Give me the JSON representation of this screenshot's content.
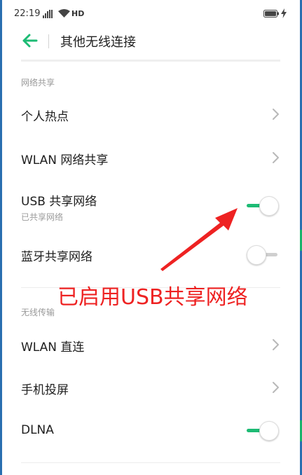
{
  "status_bar": {
    "time": "22:19",
    "network_label": "HD",
    "icons": [
      "signal-icon",
      "wifi-icon",
      "battery-icon",
      "charging-icon"
    ]
  },
  "app_bar": {
    "title": "其他无线连接",
    "back_icon": "back-arrow-icon"
  },
  "sections": {
    "sharing": {
      "header": "网络共享",
      "items": [
        {
          "label": "个人热点",
          "control": "chevron"
        },
        {
          "label": "WLAN 网络共享",
          "control": "chevron"
        },
        {
          "label": "USB 共享网络",
          "subtitle": "已共享网络",
          "control": "toggle",
          "on": true
        },
        {
          "label": "蓝牙共享网络",
          "control": "toggle",
          "on": false
        }
      ]
    },
    "wireless": {
      "header": "无线传输",
      "items": [
        {
          "label": "WLAN 直连",
          "control": "chevron"
        },
        {
          "label": "手机投屏",
          "control": "chevron"
        },
        {
          "label": "DLNA",
          "control": "toggle",
          "on": true
        }
      ]
    }
  },
  "annotation": {
    "text": "已启用USB共享网络",
    "color": "#ee2222"
  },
  "colors": {
    "accent": "#1dbb74",
    "toggle_off": "#cfcfcf",
    "annotation": "#ee2222"
  }
}
